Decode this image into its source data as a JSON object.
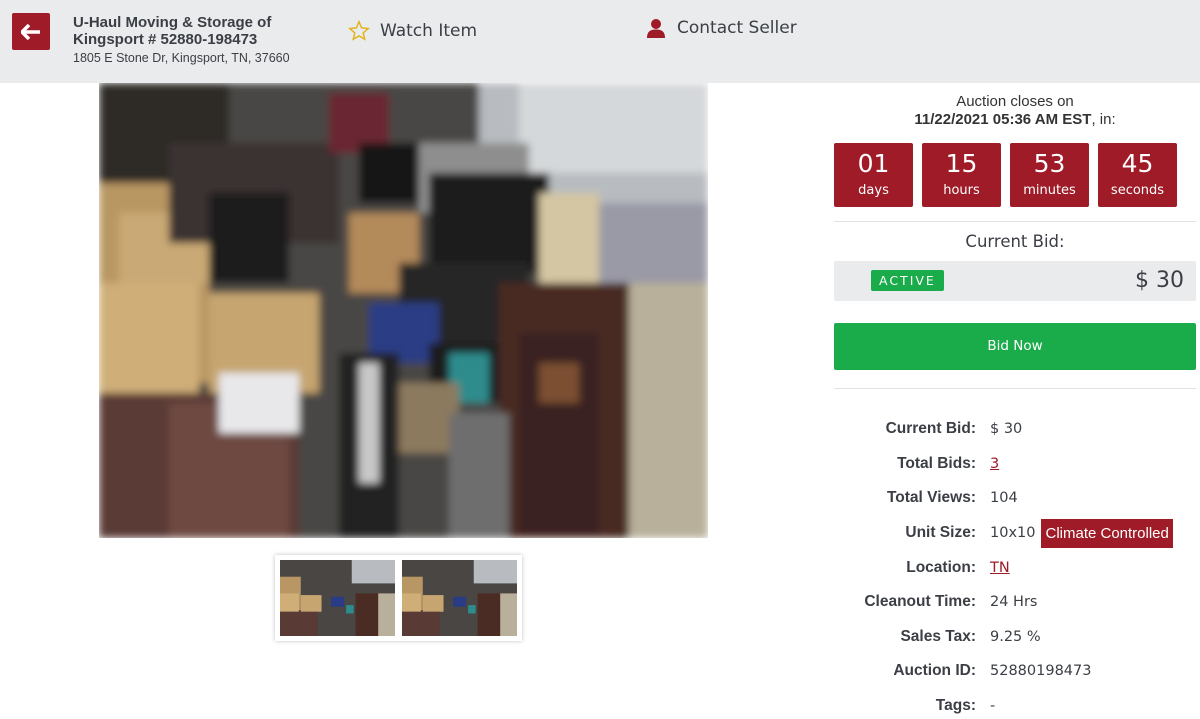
{
  "header": {
    "facility_name": "U-Haul Moving & Storage of Kingsport # 52880-198473",
    "facility_address": "1805 E Stone Dr, Kingsport, TN, 37660",
    "watch_label": "Watch Item",
    "contact_label": "Contact Seller",
    "icons": {
      "back": "arrow-left-icon",
      "watch": "star-icon",
      "contact": "person-icon"
    }
  },
  "auction": {
    "closes_label": "Auction closes on",
    "closes_date": "11/22/2021 05:36 AM EST",
    "closes_suffix": ", in:",
    "countdown": [
      {
        "value": "01",
        "unit": "days"
      },
      {
        "value": "15",
        "unit": "hours"
      },
      {
        "value": "53",
        "unit": "minutes"
      },
      {
        "value": "45",
        "unit": "seconds"
      }
    ],
    "current_bid_title": "Current Bid:",
    "status": "ACTIVE",
    "current_bid_amount": "$ 30",
    "bid_now_label": "Bid Now"
  },
  "details": {
    "current_bid_label": "Current Bid:",
    "current_bid_value": "$ 30",
    "total_bids_label": "Total Bids:",
    "total_bids_value": "3",
    "total_views_label": "Total Views:",
    "total_views_value": "104",
    "unit_size_label": "Unit Size:",
    "unit_size_value": "10x10",
    "climate_badge": "Climate Controlled",
    "location_label": "Location:",
    "location_value": "TN",
    "cleanout_label": "Cleanout Time:",
    "cleanout_value": "24 Hrs",
    "sales_tax_label": "Sales Tax:",
    "sales_tax_value": "9.25 %",
    "auction_id_label": "Auction ID:",
    "auction_id_value": "52880198473",
    "tags_label": "Tags:",
    "tags_value": "-"
  },
  "colors": {
    "brand_red": "#9e1b27",
    "active_green": "#1aab4b",
    "header_bg": "#e9ebed"
  }
}
